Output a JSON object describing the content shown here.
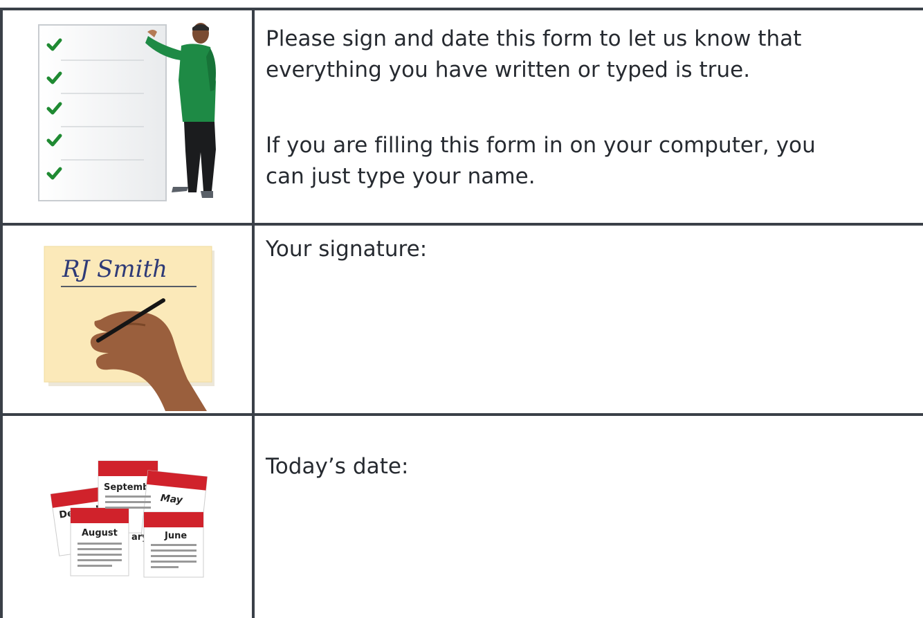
{
  "rows": [
    {
      "icon": "checklist-person-illustration",
      "paragraphs": [
        "Please sign and date this form to let us know that\neverything you have written or typed is true.",
        "If you are filling this form in on your computer, you\ncan just type your name."
      ]
    },
    {
      "icon": "signature-hand-illustration",
      "signature_text": "RJ Smith",
      "label": "Your signature:"
    },
    {
      "icon": "calendars-illustration",
      "calendar_months": [
        "Decemb",
        "Septembe",
        "May",
        "August",
        "ary",
        "June"
      ],
      "label": "Today’s date:"
    }
  ],
  "colors": {
    "border": "#3a4048",
    "text": "#262a30",
    "check": "#1f8a32",
    "shirt": "#1e8a45",
    "note": "#fbe9b9",
    "calendar_red": "#d0222b"
  }
}
